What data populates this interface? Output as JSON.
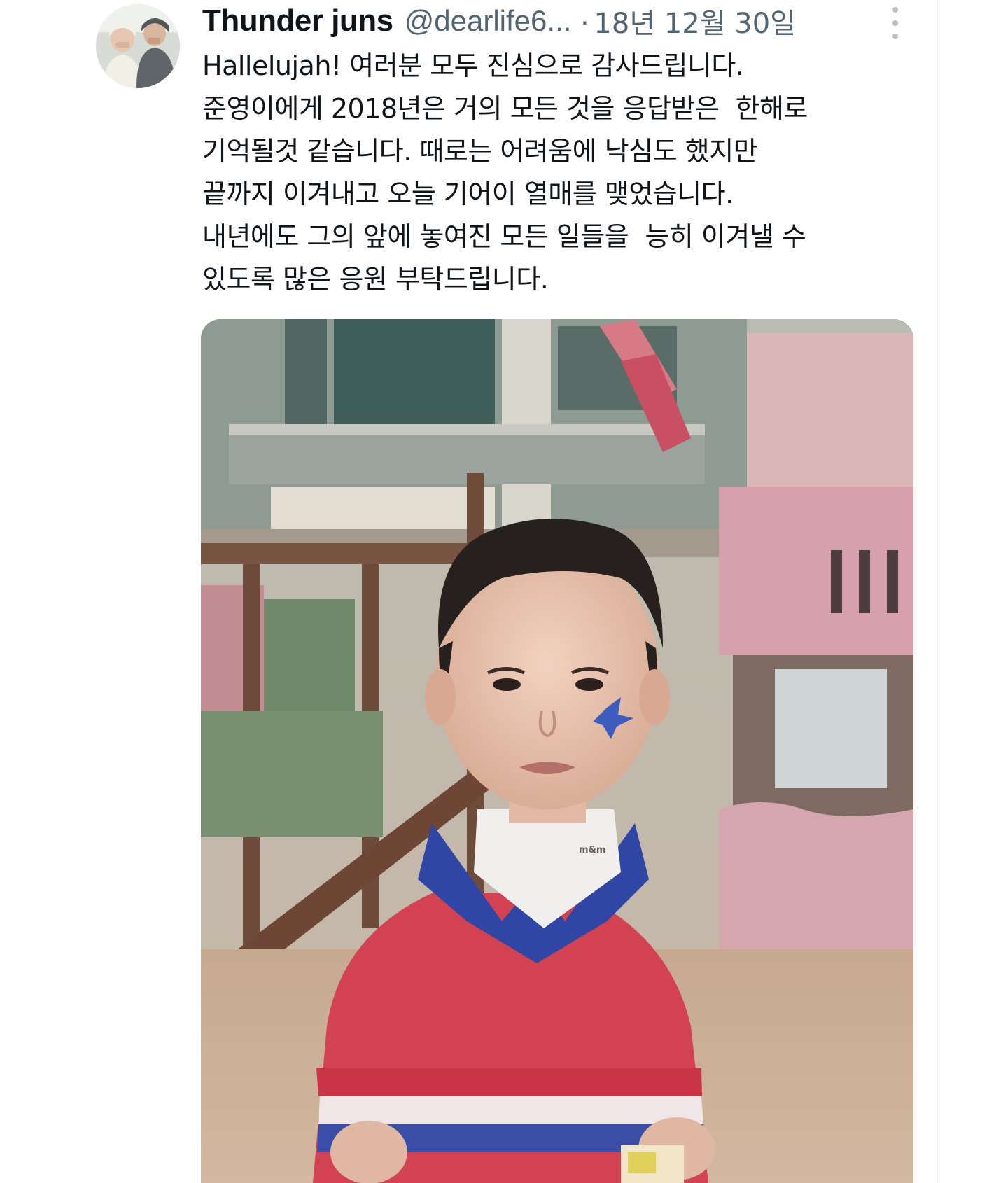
{
  "tweet": {
    "display_name": "Thunder juns",
    "handle": "@dearlife6...",
    "separator": "·",
    "date": "18년 12월 30일",
    "text_lines": [
      "Hallelujah! 여러분 모두 진심으로 감사드립니다.",
      "준영이에게 2018년은 거의 모든 것을 응답받은  한해로",
      "기억될것 같습니다. 때로는 어려움에 낙심도 했지만",
      "끝까지 이겨내고 오늘 기어이 열매를 맺었습니다.",
      "내년에도 그의 앞에 놓여진 모든 일들을  능히 이겨낼 수",
      "있도록 많은 응원 부탁드립니다."
    ],
    "shirt_logo_text": "m&m"
  },
  "icons": {
    "more": "more-vertical-icon"
  },
  "colors": {
    "text_primary": "#0f1419",
    "text_secondary": "#536471",
    "border": "#eff3f4"
  }
}
